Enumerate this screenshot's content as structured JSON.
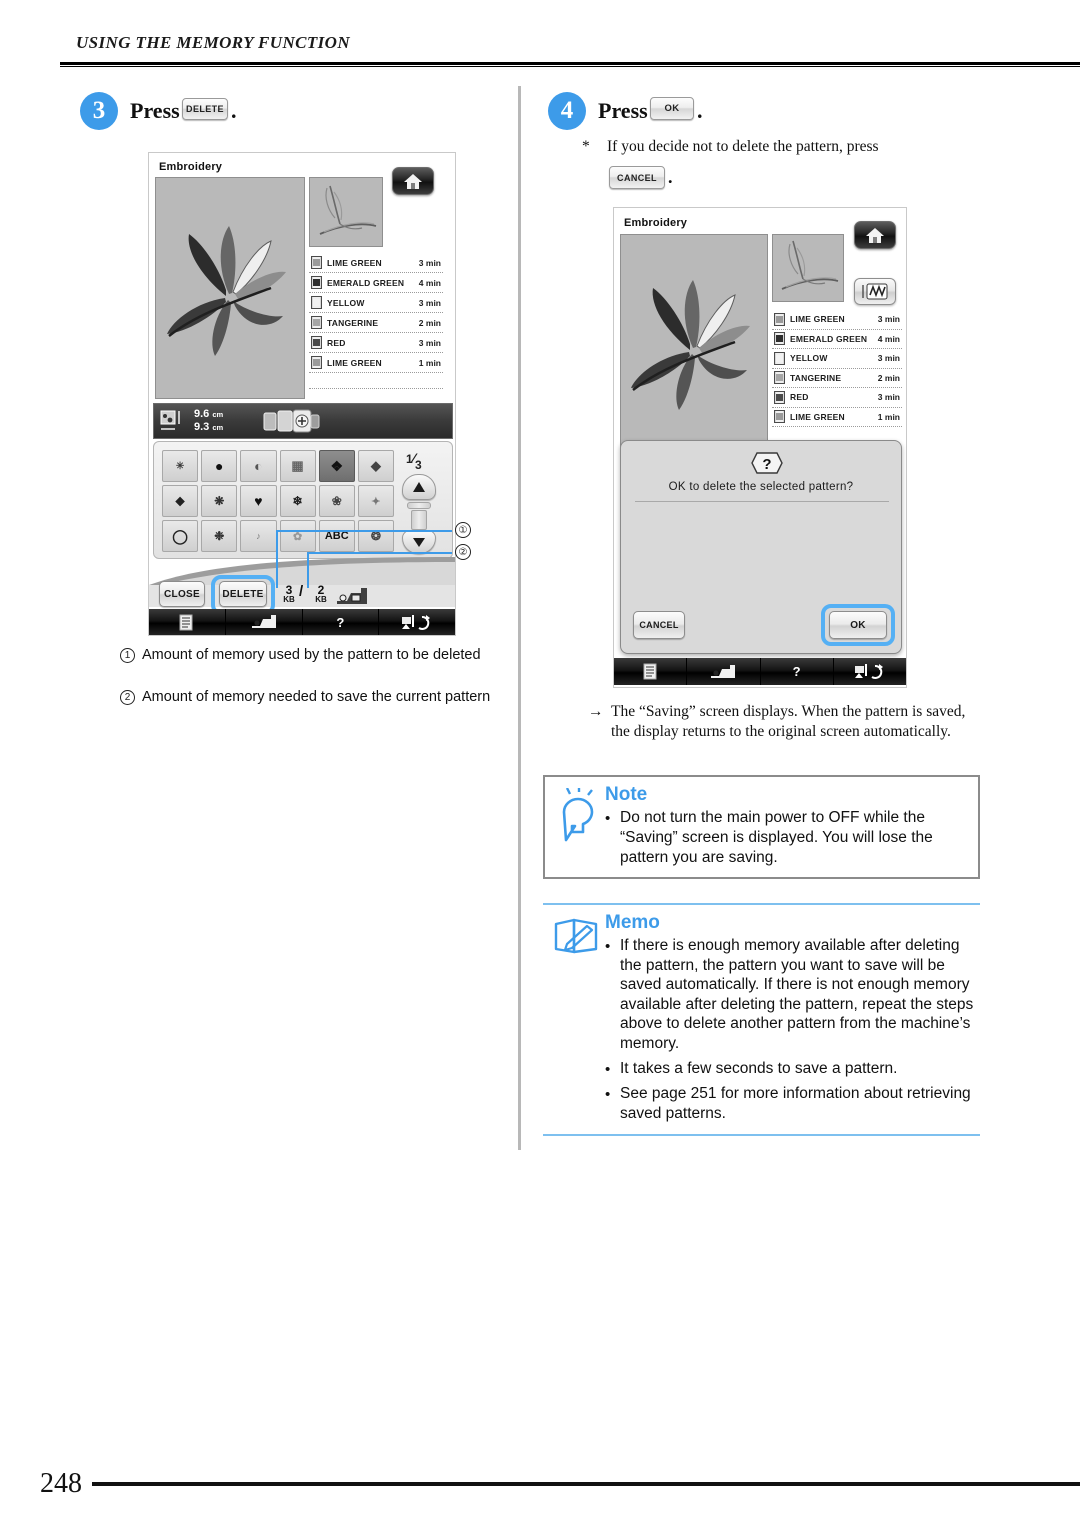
{
  "header": {
    "running_head": "USING THE MEMORY FUNCTION"
  },
  "page": {
    "number": "248"
  },
  "steps": {
    "step3": {
      "num": "3",
      "press_label": "Press",
      "button_label": "DELETE",
      "period": "."
    },
    "step4": {
      "num": "4",
      "press_label": "Press",
      "button_label": "OK",
      "period": ".",
      "star": "*",
      "star_text": "If you decide not to delete the pattern, press",
      "cancel_label": "CANCEL",
      "cancel_period": "."
    }
  },
  "screen_left": {
    "title": "Embroidery",
    "home_icon": "home-icon",
    "threads": [
      {
        "name": "LIME GREEN",
        "time": "3 min",
        "color": "#9a9a9a"
      },
      {
        "name": "EMERALD GREEN",
        "time": "4 min",
        "color": "#2e2e2e"
      },
      {
        "name": "YELLOW",
        "time": "3 min",
        "color": "#f2f2f2"
      },
      {
        "name": "TANGERINE",
        "time": "2 min",
        "color": "#a6a6a6"
      },
      {
        "name": "RED",
        "time": "3 min",
        "color": "#4a4a4a"
      },
      {
        "name": "LIME GREEN",
        "time": "1 min",
        "color": "#9a9a9a"
      }
    ],
    "size": {
      "width": "9.6",
      "height": "9.3",
      "unit": "cm"
    },
    "page_indicator": {
      "current": "1",
      "total": "3"
    },
    "patterns": [
      "",
      "",
      "",
      "",
      "",
      "",
      "",
      "",
      "",
      "",
      "",
      "",
      "",
      "",
      "",
      "",
      "ABC",
      ""
    ],
    "selected_pattern_index": 4,
    "buttons": {
      "close": "CLOSE",
      "delete": "DELETE"
    },
    "memory": {
      "used": "3",
      "used_unit": "KB",
      "slash": "/",
      "needed": "2",
      "needed_unit": "KB"
    },
    "bottom_bar": [
      "list-icon",
      "machine-icon",
      "help-icon",
      "needle-icon"
    ]
  },
  "callouts": {
    "marker1": "①",
    "marker2": "②",
    "caption1": "Amount of memory used by the pattern to be deleted",
    "caption2": "Amount of memory needed to save the current pattern"
  },
  "screen_right": {
    "title": "Embroidery",
    "home_icon": "home-icon",
    "mw_icon": "thread-cut-icon",
    "threads": [
      {
        "name": "LIME GREEN",
        "time": "3 min",
        "color": "#9a9a9a"
      },
      {
        "name": "EMERALD GREEN",
        "time": "4 min",
        "color": "#2e2e2e"
      },
      {
        "name": "YELLOW",
        "time": "3 min",
        "color": "#f2f2f2"
      },
      {
        "name": "TANGERINE",
        "time": "2 min",
        "color": "#a6a6a6"
      },
      {
        "name": "RED",
        "time": "3 min",
        "color": "#4a4a4a"
      },
      {
        "name": "LIME GREEN",
        "time": "1 min",
        "color": "#9a9a9a"
      }
    ],
    "dialog": {
      "icon": "question-icon",
      "message": "OK to delete the selected pattern?",
      "cancel": "CANCEL",
      "ok": "OK"
    },
    "bottom_bar": [
      "list-icon",
      "machine-icon",
      "help-icon",
      "needle-icon"
    ]
  },
  "result_note": {
    "arrow": "→",
    "text": "The “Saving” screen displays. When the pattern is saved, the display returns to the original screen automatically."
  },
  "note": {
    "title": "Note",
    "icon": "lightbulb-icon",
    "bullet": "•",
    "text": "Do not turn the main power to OFF while the “Saving” screen is displayed. You will lose the pattern you are saving."
  },
  "memo": {
    "title": "Memo",
    "icon": "notebook-icon",
    "bullet": "•",
    "items": [
      "If there is enough memory available after deleting the pattern, the pattern you want to save will be saved automatically. If there is not enough memory available after deleting the pattern, repeat the steps above to delete another pattern from the machine’s memory.",
      "It takes a few seconds to save a pattern.",
      "See page 251 for more information about retrieving saved patterns."
    ]
  },
  "colors": {
    "accent": "#3d9be9",
    "highlight": "#55b0f4",
    "rule": "#7ec0ef"
  }
}
